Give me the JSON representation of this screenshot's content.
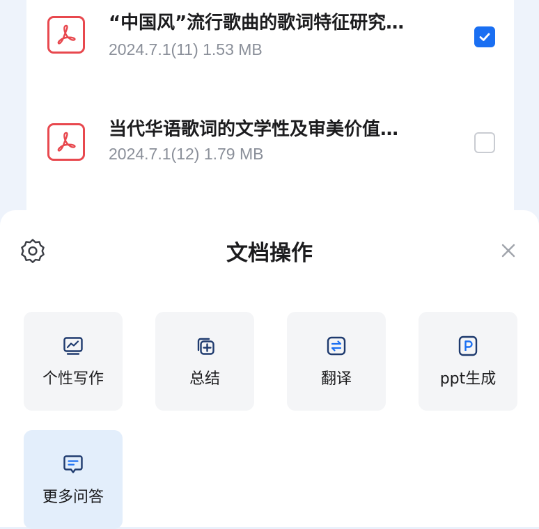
{
  "files": [
    {
      "title": "“中国风”流行歌曲的歌词特征研究…",
      "meta": "2024.7.1(11) 1.53 MB",
      "icon": "pdf-icon",
      "checked": true
    },
    {
      "title": "当代华语歌词的文学性及审美价值…",
      "meta": "2024.7.1(12) 1.79 MB",
      "icon": "pdf-icon",
      "checked": false
    }
  ],
  "sheet": {
    "title": "文档操作",
    "settings_icon": "gear-icon",
    "close_icon": "close-icon"
  },
  "actions": [
    {
      "label": "个性写作",
      "icon": "chart-monitor-icon"
    },
    {
      "label": "总结",
      "icon": "stacked-add-icon"
    },
    {
      "label": "翻译",
      "icon": "swap-arrows-icon"
    },
    {
      "label": "ppt生成",
      "icon": "ppt-p-icon"
    },
    {
      "label": "更多问答",
      "icon": "chat-bubble-icon",
      "selected": true
    }
  ],
  "colors": {
    "accent": "#1a6ff2",
    "pdf_red": "#e8484e",
    "icon_navy": "#1e3a6e"
  }
}
